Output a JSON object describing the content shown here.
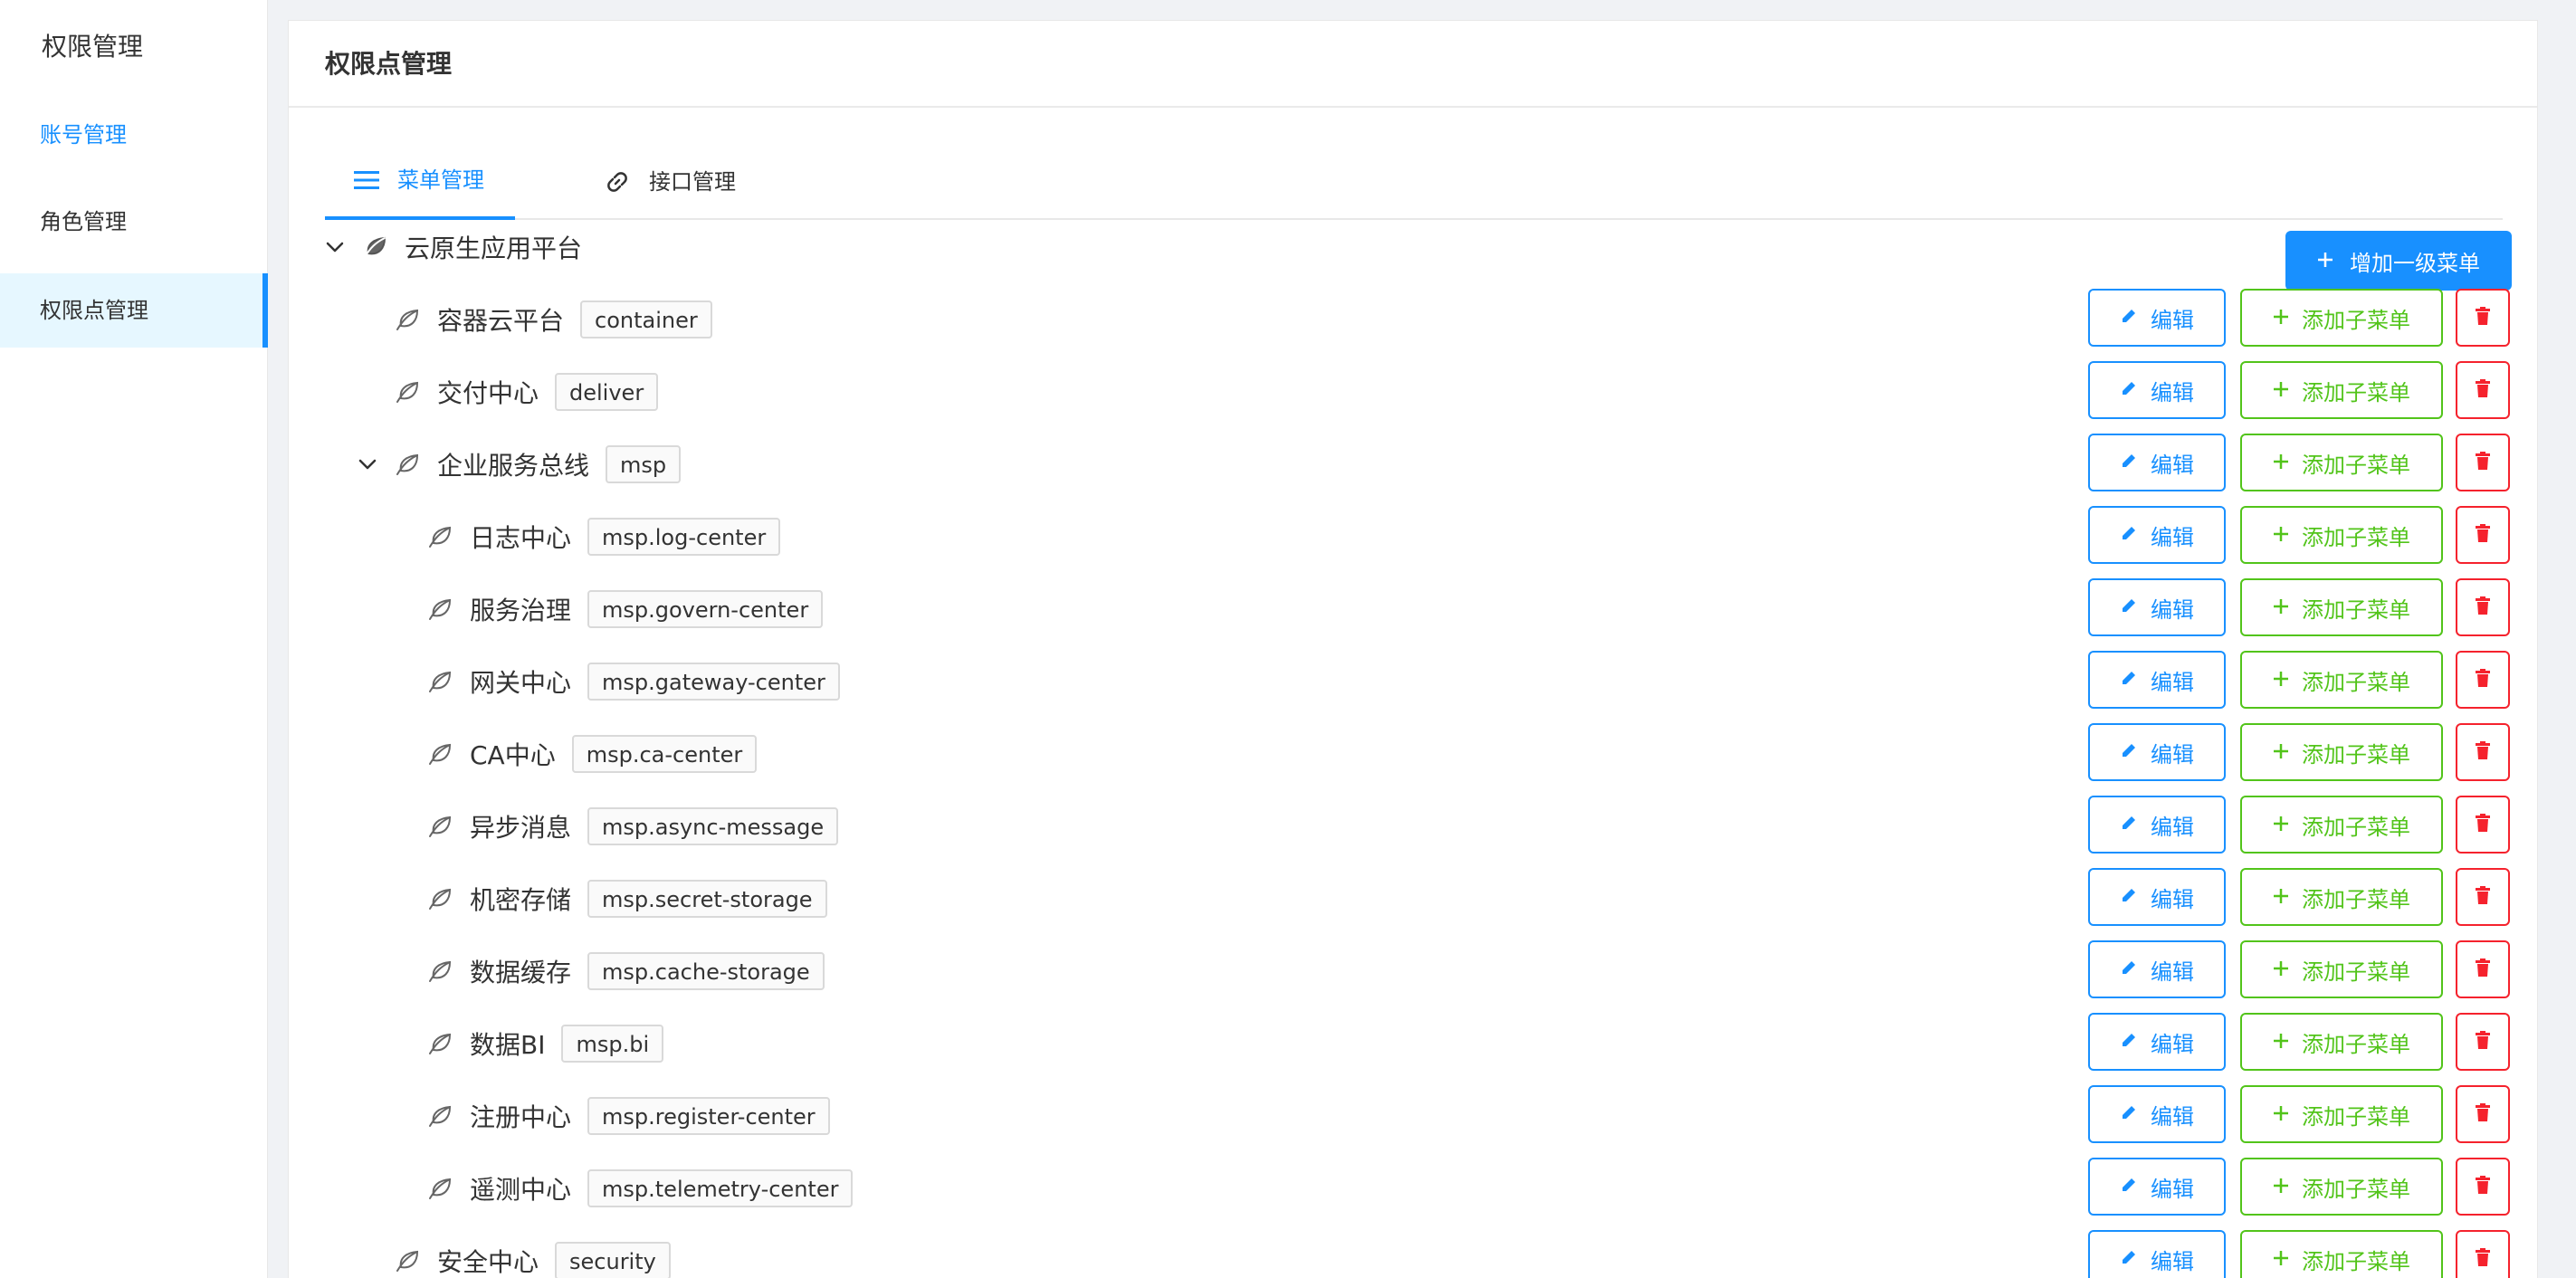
{
  "sidebar": {
    "title": "权限管理",
    "items": [
      {
        "label": "账号管理"
      },
      {
        "label": "角色管理"
      },
      {
        "label": "权限点管理"
      }
    ]
  },
  "card": {
    "title": "权限点管理"
  },
  "tabs": [
    {
      "label": "菜单管理",
      "icon": "menu-icon"
    },
    {
      "label": "接口管理",
      "icon": "link-icon"
    }
  ],
  "add_top_label": "增加一级菜单",
  "actions": {
    "edit": "编辑",
    "add_child": "添加子菜单"
  },
  "tree": [
    {
      "label": "云原生应用平台",
      "code": "",
      "level": 0,
      "expanded": true
    },
    {
      "label": "容器云平台",
      "code": "container",
      "level": 1
    },
    {
      "label": "交付中心",
      "code": "deliver",
      "level": 1
    },
    {
      "label": "企业服务总线",
      "code": "msp",
      "level": 1,
      "expanded": true
    },
    {
      "label": "日志中心",
      "code": "msp.log-center",
      "level": 2
    },
    {
      "label": "服务治理",
      "code": "msp.govern-center",
      "level": 2
    },
    {
      "label": "网关中心",
      "code": "msp.gateway-center",
      "level": 2
    },
    {
      "label": "CA中心",
      "code": "msp.ca-center",
      "level": 2
    },
    {
      "label": "异步消息",
      "code": "msp.async-message",
      "level": 2
    },
    {
      "label": "机密存储",
      "code": "msp.secret-storage",
      "level": 2
    },
    {
      "label": "数据缓存",
      "code": "msp.cache-storage",
      "level": 2
    },
    {
      "label": "数据BI",
      "code": "msp.bi",
      "level": 2
    },
    {
      "label": "注册中心",
      "code": "msp.register-center",
      "level": 2
    },
    {
      "label": "遥测中心",
      "code": "msp.telemetry-center",
      "level": 2
    },
    {
      "label": "安全中心",
      "code": "security",
      "level": 1
    }
  ],
  "colors": {
    "primary": "#1890ff",
    "success": "#52c41a",
    "danger": "#f5222d"
  }
}
